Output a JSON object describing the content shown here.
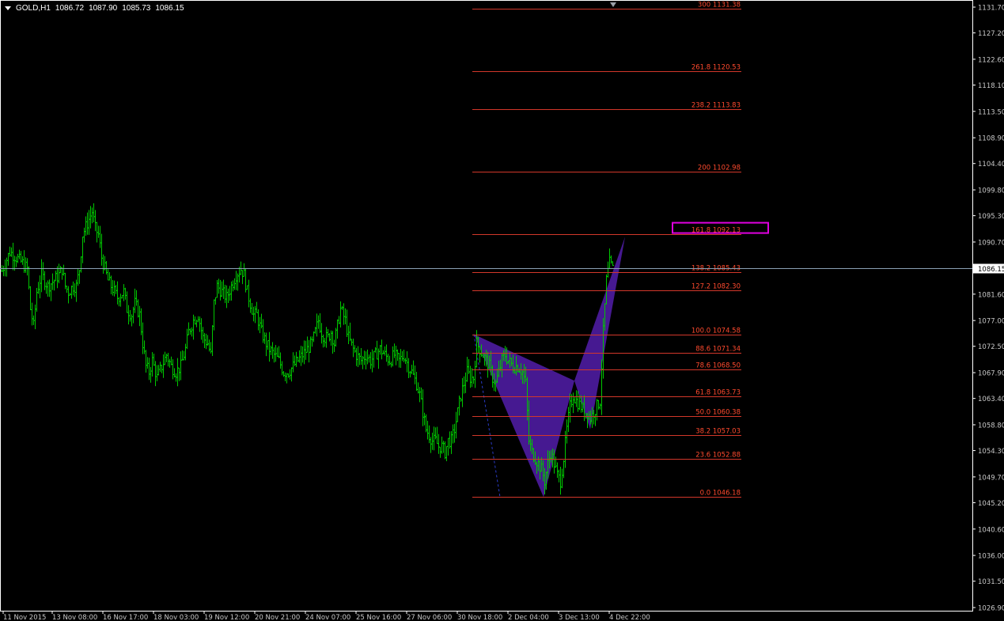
{
  "header": {
    "symbol": "GOLD,H1",
    "ohlc": [
      "1086.72",
      "1087.90",
      "1085.73",
      "1086.15"
    ]
  },
  "colors": {
    "background": "#000000",
    "candles": "#00c800",
    "fib_line": "#d2372a",
    "fib_label": "#ff4a2e",
    "pattern_fill": "#4a1a99",
    "price_line": "#8aa0b4",
    "highlight_box": "#e000e0",
    "axis_text": "#c8c8c8",
    "axis_line": "#ffffff"
  },
  "chart_data": {
    "type": "candlestick",
    "symbol": "GOLD",
    "timeframe": "H1",
    "ylim": [
      1026.9,
      1133.0
    ],
    "y_ticks": [
      "1131.70",
      "1127.20",
      "1122.60",
      "1118.10",
      "1113.50",
      "1108.90",
      "1104.40",
      "1099.80",
      "1095.30",
      "1090.70",
      "1081.60",
      "1077.00",
      "1072.50",
      "1067.90",
      "1063.40",
      "1058.80",
      "1054.30",
      "1049.70",
      "1045.20",
      "1040.60",
      "1036.00",
      "1031.50",
      "1026.90"
    ],
    "x_ticks": [
      "11 Nov 2015",
      "13 Nov 08:00",
      "16 Nov 17:00",
      "18 Nov 03:00",
      "19 Nov 12:00",
      "20 Nov 21:00",
      "24 Nov 07:00",
      "25 Nov 16:00",
      "27 Nov 06:00",
      "30 Nov 18:00",
      "2 Dec 04:00",
      "3 Dec 13:00",
      "4 Dec 22:00"
    ],
    "current_price": "1086.15",
    "close_path": [
      [
        0,
        1085
      ],
      [
        6,
        1087
      ],
      [
        12,
        1089
      ],
      [
        20,
        1088
      ],
      [
        28,
        1087
      ],
      [
        34,
        1086
      ],
      [
        38,
        1079
      ],
      [
        42,
        1076
      ],
      [
        46,
        1082
      ],
      [
        52,
        1085
      ],
      [
        60,
        1083
      ],
      [
        68,
        1084
      ],
      [
        74,
        1085
      ],
      [
        78,
        1086
      ],
      [
        82,
        1083
      ],
      [
        86,
        1082
      ],
      [
        92,
        1083
      ],
      [
        96,
        1083
      ],
      [
        100,
        1086
      ],
      [
        104,
        1092
      ],
      [
        110,
        1094
      ],
      [
        116,
        1096
      ],
      [
        120,
        1093
      ],
      [
        124,
        1092
      ],
      [
        128,
        1088
      ],
      [
        132,
        1086
      ],
      [
        136,
        1084
      ],
      [
        140,
        1083
      ],
      [
        148,
        1081
      ],
      [
        156,
        1082
      ],
      [
        160,
        1079
      ],
      [
        166,
        1078
      ],
      [
        170,
        1080
      ],
      [
        176,
        1078
      ],
      [
        180,
        1073
      ],
      [
        184,
        1069
      ],
      [
        188,
        1068
      ],
      [
        192,
        1070
      ],
      [
        198,
        1067
      ],
      [
        204,
        1069
      ],
      [
        210,
        1071
      ],
      [
        216,
        1069
      ],
      [
        222,
        1068
      ],
      [
        228,
        1069
      ],
      [
        234,
        1072
      ],
      [
        238,
        1075
      ],
      [
        244,
        1077
      ],
      [
        250,
        1078
      ],
      [
        256,
        1074
      ],
      [
        262,
        1073
      ],
      [
        266,
        1071
      ],
      [
        270,
        1080
      ],
      [
        274,
        1083
      ],
      [
        280,
        1082
      ],
      [
        286,
        1081
      ],
      [
        292,
        1083
      ],
      [
        298,
        1085
      ],
      [
        304,
        1086
      ],
      [
        308,
        1085
      ],
      [
        312,
        1082
      ],
      [
        316,
        1080
      ],
      [
        320,
        1078
      ],
      [
        324,
        1078
      ],
      [
        330,
        1075
      ],
      [
        336,
        1073
      ],
      [
        340,
        1072
      ],
      [
        346,
        1071
      ],
      [
        352,
        1070
      ],
      [
        358,
        1068
      ],
      [
        364,
        1068
      ],
      [
        370,
        1069
      ],
      [
        376,
        1070
      ],
      [
        382,
        1071
      ],
      [
        388,
        1072
      ],
      [
        394,
        1073
      ],
      [
        398,
        1075
      ],
      [
        402,
        1077
      ],
      [
        406,
        1075
      ],
      [
        410,
        1074
      ],
      [
        414,
        1074
      ],
      [
        418,
        1075
      ],
      [
        422,
        1073
      ],
      [
        426,
        1076
      ],
      [
        430,
        1079
      ],
      [
        436,
        1077
      ],
      [
        440,
        1074
      ],
      [
        446,
        1072
      ],
      [
        450,
        1071
      ],
      [
        456,
        1070
      ],
      [
        462,
        1071
      ],
      [
        468,
        1070
      ],
      [
        474,
        1071
      ],
      [
        480,
        1072
      ],
      [
        486,
        1071
      ],
      [
        492,
        1070
      ],
      [
        498,
        1071
      ],
      [
        504,
        1070
      ],
      [
        510,
        1071
      ],
      [
        516,
        1069
      ],
      [
        520,
        1068
      ],
      [
        526,
        1066
      ],
      [
        530,
        1064
      ],
      [
        534,
        1061
      ],
      [
        538,
        1058
      ],
      [
        542,
        1057
      ],
      [
        546,
        1056
      ],
      [
        550,
        1056
      ],
      [
        554,
        1055
      ],
      [
        558,
        1055
      ],
      [
        562,
        1054
      ],
      [
        566,
        1056
      ],
      [
        570,
        1056
      ],
      [
        574,
        1058
      ],
      [
        578,
        1061
      ],
      [
        582,
        1064
      ],
      [
        586,
        1066
      ],
      [
        590,
        1068
      ],
      [
        594,
        1067
      ],
      [
        598,
        1067
      ],
      [
        602,
        1073
      ],
      [
        606,
        1072
      ],
      [
        610,
        1071
      ],
      [
        614,
        1070
      ],
      [
        618,
        1069
      ],
      [
        622,
        1067
      ],
      [
        626,
        1066
      ],
      [
        630,
        1068
      ],
      [
        634,
        1070
      ],
      [
        638,
        1071
      ],
      [
        642,
        1070
      ],
      [
        648,
        1069
      ],
      [
        654,
        1069
      ],
      [
        660,
        1068
      ],
      [
        664,
        1066
      ],
      [
        668,
        1056
      ],
      [
        672,
        1054
      ],
      [
        676,
        1053
      ],
      [
        680,
        1052
      ],
      [
        684,
        1051
      ],
      [
        688,
        1049
      ],
      [
        692,
        1052
      ],
      [
        696,
        1054
      ],
      [
        700,
        1052
      ],
      [
        704,
        1050
      ],
      [
        708,
        1049
      ],
      [
        712,
        1053
      ],
      [
        716,
        1058
      ],
      [
        720,
        1062
      ],
      [
        724,
        1064
      ],
      [
        728,
        1063
      ],
      [
        734,
        1062
      ],
      [
        738,
        1061
      ],
      [
        742,
        1061
      ],
      [
        746,
        1060
      ],
      [
        750,
        1061
      ],
      [
        754,
        1062
      ],
      [
        758,
        1063
      ],
      [
        762,
        1075
      ],
      [
        766,
        1084
      ],
      [
        770,
        1087
      ],
      [
        774,
        1086
      ]
    ],
    "fib_levels": [
      {
        "label": "300 1131.38",
        "value": 1131.38
      },
      {
        "label": "261.8 1120.53",
        "value": 1120.53
      },
      {
        "label": "238.2 1113.83",
        "value": 1113.83
      },
      {
        "label": "200 1102.98",
        "value": 1102.98
      },
      {
        "label": "161.8 1092.13",
        "value": 1092.13
      },
      {
        "label": "138.2 1085.43",
        "value": 1085.43
      },
      {
        "label": "127.2 1082.30",
        "value": 1082.3
      },
      {
        "label": "100.0 1074.58",
        "value": 1074.58
      },
      {
        "label": "88.6 1071.34",
        "value": 1071.34
      },
      {
        "label": "78.6 1068.50",
        "value": 1068.5
      },
      {
        "label": "61.8 1063.73",
        "value": 1063.73
      },
      {
        "label": "50.0 1060.38",
        "value": 1060.38
      },
      {
        "label": "38.2 1057.03",
        "value": 1057.03
      },
      {
        "label": "23.6 1052.88",
        "value": 1052.88
      },
      {
        "label": "0.0 1046.18",
        "value": 1046.18
      }
    ],
    "highlighted_level": "161.8 1092.13",
    "harmonic_pattern": {
      "points": [
        [
          599,
          1074.58
        ],
        [
          687,
          1046.18
        ],
        [
          726,
          1066.5
        ],
        [
          746,
          1058.0
        ],
        [
          790,
          1091.6
        ]
      ]
    }
  }
}
